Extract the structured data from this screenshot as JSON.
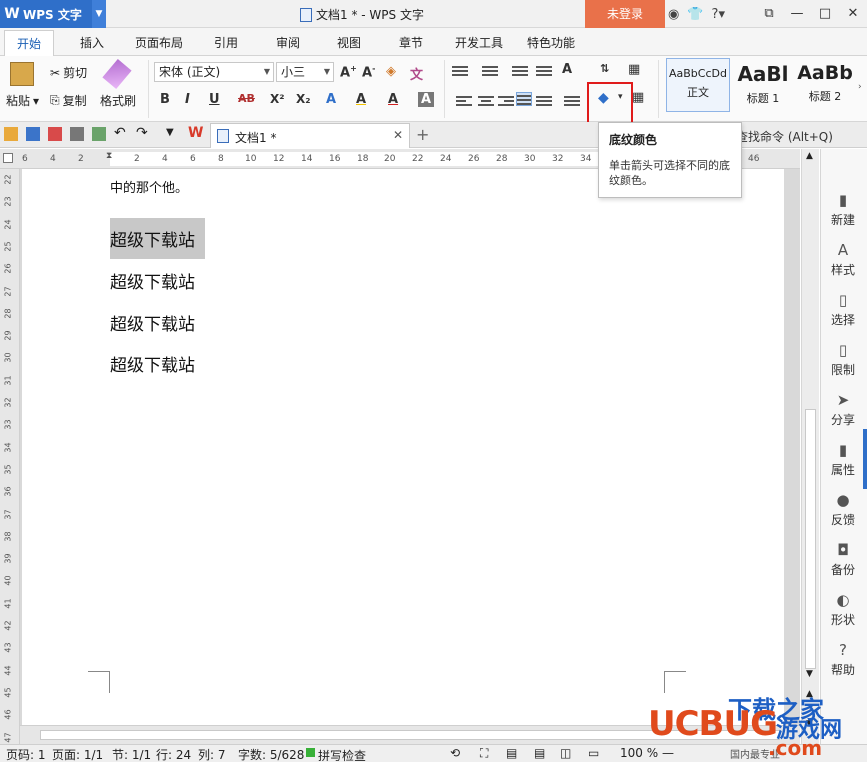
{
  "app": {
    "name": "WPS 文字",
    "logo": "W"
  },
  "title_bar": {
    "doc_title": "文档1 * - WPS 文字",
    "login_label": "未登录",
    "help": "?"
  },
  "menu_tabs": [
    "开始",
    "插入",
    "页面布局",
    "引用",
    "审阅",
    "视图",
    "章节",
    "开发工具",
    "特色功能"
  ],
  "ribbon": {
    "paste_label": "粘贴",
    "cut_label": "剪切",
    "copy_label": "复制",
    "format_painter_label": "格式刷",
    "font_name": "宋体 (正文)",
    "font_size": "小三",
    "format_buttons": [
      "B",
      "I",
      "U",
      "AB",
      "X²",
      "X₂",
      "A",
      "A",
      "A"
    ],
    "styles": [
      {
        "sample": "AaBbCcDd",
        "label": "正文"
      },
      {
        "sample": "AaBl",
        "label": "标题 1"
      },
      {
        "sample": "AaBb",
        "label": "标题 2"
      }
    ]
  },
  "quick_bar": {
    "doc_tab_label": "文档1 *",
    "search_cmd": "查找命令 (Alt+Q)"
  },
  "hruler_nums": [
    "6",
    "4",
    "2",
    "2",
    "4",
    "6",
    "8",
    "10",
    "12",
    "14",
    "16",
    "18",
    "20",
    "22",
    "24",
    "26",
    "28",
    "30",
    "32",
    "34",
    "36",
    "38",
    "40",
    "42",
    "44",
    "46"
  ],
  "vruler_nums": [
    "22",
    "23",
    "24",
    "25",
    "26",
    "27",
    "28",
    "29",
    "30",
    "31",
    "32",
    "33",
    "34",
    "35",
    "36",
    "37",
    "38",
    "39",
    "40",
    "41",
    "42",
    "43",
    "44",
    "45",
    "46",
    "47"
  ],
  "document": {
    "paragraphs": [
      "中的那个他。",
      "超级下载站",
      "超级下载站",
      "超级下载站",
      "超级下载站"
    ]
  },
  "tooltip": {
    "title": "底纹颜色",
    "desc": "单击箭头可选择不同的底纹颜色。"
  },
  "side_panel": [
    {
      "label": "新建",
      "icon": "new-icon"
    },
    {
      "label": "样式",
      "icon": "style-icon"
    },
    {
      "label": "选择",
      "icon": "select-icon"
    },
    {
      "label": "限制",
      "icon": "restrict-icon"
    },
    {
      "label": "分享",
      "icon": "share-icon"
    },
    {
      "label": "属性",
      "icon": "properties-icon"
    },
    {
      "label": "反馈",
      "icon": "feedback-icon"
    },
    {
      "label": "备份",
      "icon": "backup-icon"
    },
    {
      "label": "形状",
      "icon": "shape-icon"
    },
    {
      "label": "帮助",
      "icon": "help-icon"
    }
  ],
  "status_bar": {
    "page_num": "页码: 1",
    "pages": "页面: 1/1",
    "section": "节: 1/1",
    "row": "行: 24",
    "col": "列: 7",
    "words": "字数: 5/628",
    "spell": "拼写检查",
    "zoom": "100 %",
    "notice": "国内最专业"
  },
  "watermark": {
    "top": "下载之家",
    "brand": "UCBUG",
    "game": "游戏网",
    "domain": ".com"
  },
  "colors": {
    "accent": "#2f6fc9",
    "login": "#e9714a",
    "highlight_box": "#e01b1b",
    "selection": "#c8c8c8"
  }
}
